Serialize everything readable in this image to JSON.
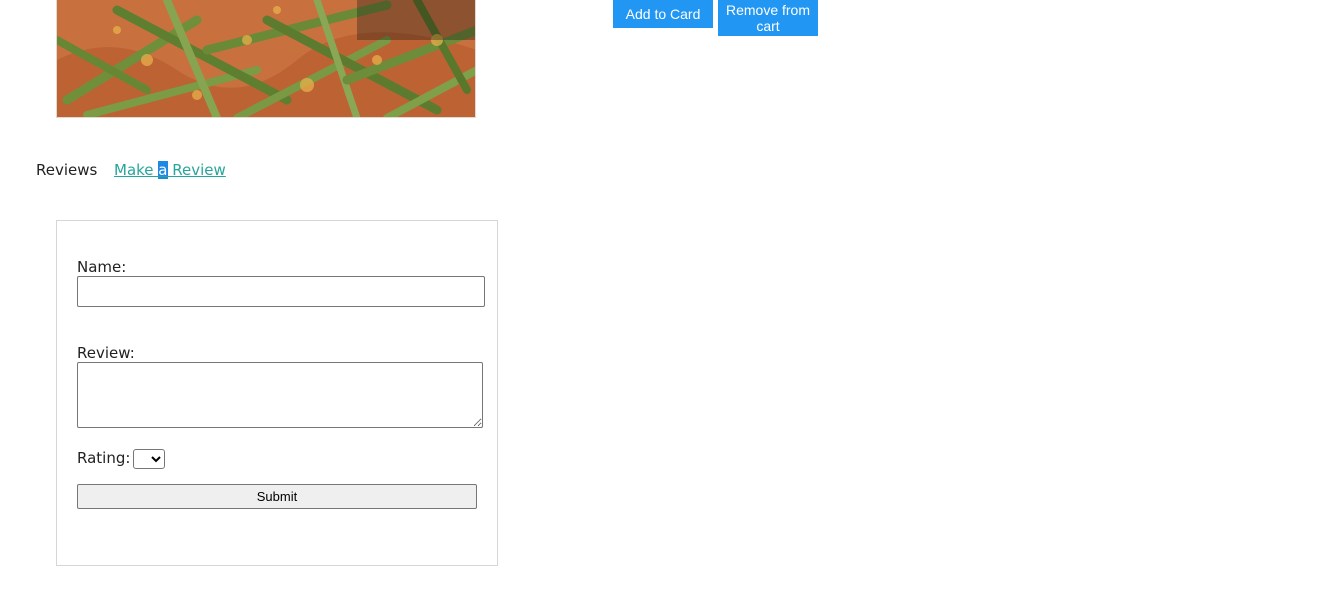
{
  "product": {
    "image_alt": "green beans"
  },
  "cart": {
    "add_label": "Add to Card",
    "remove_label": "Remove from cart"
  },
  "tabs": {
    "reviews_label": "Reviews",
    "make_review_before": " Make ",
    "make_review_highlight": "a",
    "make_review_after": " Review"
  },
  "form": {
    "name_label": "Name:",
    "name_value": "",
    "review_label": "Review:",
    "review_value": "",
    "rating_label": "Rating:",
    "rating_selected": "",
    "submit_label": "Submit"
  }
}
